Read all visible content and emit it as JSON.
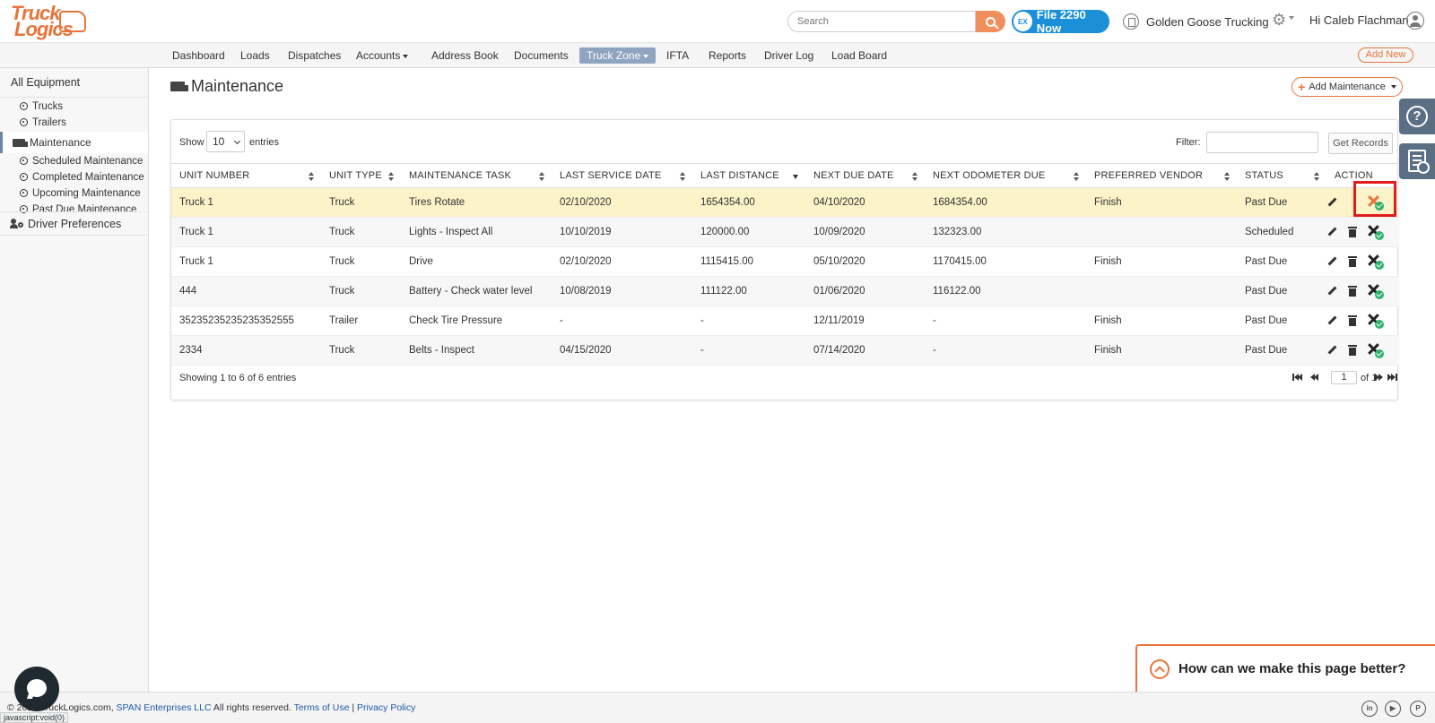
{
  "header": {
    "logo_line1": "Truck",
    "logo_line2": "Logics",
    "search_placeholder": "Search",
    "file_badge": "EX",
    "file_button": "File 2290 Now",
    "company": "Golden Goose Trucking",
    "greeting": "Hi Caleb Flachman"
  },
  "nav": {
    "items": [
      "Dashboard",
      "Loads",
      "Dispatches",
      "Accounts",
      "Address Book",
      "Documents",
      "Truck Zone",
      "IFTA",
      "Reports",
      "Driver Log",
      "Load Board"
    ],
    "active": "Truck Zone",
    "add_new": "Add New"
  },
  "sidebar": {
    "all_equipment": "All Equipment",
    "trucks": "Trucks",
    "trailers": "Trailers",
    "maintenance": "Maintenance",
    "scheduled": "Scheduled Maintenance",
    "completed": "Completed Maintenance",
    "upcoming": "Upcoming Maintenance",
    "past_due": "Past Due Maintenance",
    "driver_prefs": "Driver Preferences"
  },
  "main": {
    "title": "Maintenance",
    "add_button": "Add Maintenance",
    "show": "Show",
    "entries_value": "10",
    "entries": "entries",
    "filter": "Filter:",
    "get_records": "Get Records",
    "columns": [
      "UNIT NUMBER",
      "UNIT TYPE",
      "MAINTENANCE TASK",
      "LAST SERVICE DATE",
      "LAST DISTANCE",
      "NEXT DUE DATE",
      "NEXT ODOMETER DUE",
      "PREFERRED VENDOR",
      "STATUS",
      "ACTION"
    ],
    "rows": [
      [
        "Truck 1",
        "Truck",
        "Tires Rotate",
        "02/10/2020",
        "1654354.00",
        "04/10/2020",
        "1684354.00",
        "Finish",
        "Past Due"
      ],
      [
        "Truck 1",
        "Truck",
        "Lights - Inspect All",
        "10/10/2019",
        "120000.00",
        "10/09/2020",
        "132323.00",
        "",
        "Scheduled"
      ],
      [
        "Truck 1",
        "Truck",
        "Drive",
        "02/10/2020",
        "1115415.00",
        "05/10/2020",
        "1170415.00",
        "Finish",
        "Past Due"
      ],
      [
        "444",
        "Truck",
        "Battery - Check water level",
        "10/08/2019",
        "111122.00",
        "01/06/2020",
        "116122.00",
        "",
        "Past Due"
      ],
      [
        "35235235235235352555",
        "Trailer",
        "Check Tire Pressure",
        "-",
        "-",
        "12/11/2019",
        "-",
        "Finish",
        "Past Due"
      ],
      [
        "2334",
        "Truck",
        "Belts - Inspect",
        "04/15/2020",
        "-",
        "07/14/2020",
        "-",
        "Finish",
        "Past Due"
      ]
    ],
    "showing": "Showing 1 to 6 of 6 entries",
    "page": "1",
    "of_pages": "of 1"
  },
  "feedback": "How can we make this page better?",
  "footer": {
    "copy": "© 2020 TruckLogics.com, ",
    "company_link": "SPAN Enterprises LLC",
    "rights": " All rights reserved. ",
    "terms": "Terms of Use",
    "sep": " | ",
    "privacy": "Privacy Policy",
    "status_url": "javascript:void(0)"
  },
  "colors": {
    "brand_orange": "#e8743b",
    "nav_active": "#8fa4bf",
    "highlight_row": "#fcf3c9",
    "file_blue": "#1b8fd8",
    "red_highlight": "#e01d1d"
  }
}
